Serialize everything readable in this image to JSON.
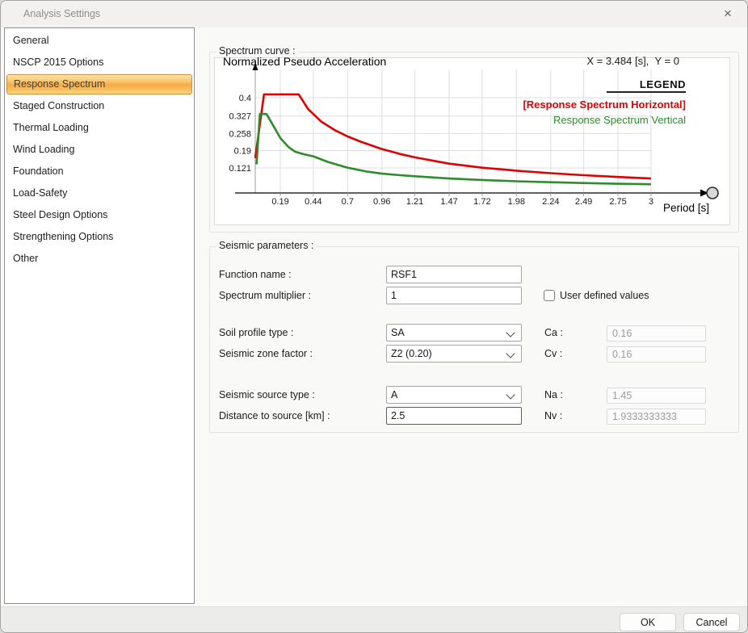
{
  "window": {
    "title": "Analysis Settings",
    "close_icon": "×"
  },
  "sidebar": {
    "selected_index": 2,
    "items": [
      {
        "label": "General"
      },
      {
        "label": "NSCP 2015 Options"
      },
      {
        "label": "Response Spectrum"
      },
      {
        "label": "Staged Construction"
      },
      {
        "label": "Thermal Loading"
      },
      {
        "label": "Wind Loading"
      },
      {
        "label": "Foundation"
      },
      {
        "label": "Load-Safety"
      },
      {
        "label": "Steel Design Options"
      },
      {
        "label": "Strengthening Options"
      },
      {
        "label": "Other"
      }
    ]
  },
  "spectrum_group": {
    "label": "Spectrum curve :",
    "chart_title": "Normalized Pseudo Acceleration",
    "readout": "X = 3.484 [s],  Y = 0",
    "legend_title": "LEGEND",
    "legend": [
      {
        "label": "[Response Spectrum Horizontal]",
        "color": "#e00000"
      },
      {
        "label": "Response Spectrum Vertical",
        "color": "#2e8b2e"
      }
    ],
    "x_axis_label": "Period [s]"
  },
  "chart_data": {
    "type": "line",
    "title": "Normalized Pseudo Acceleration",
    "xlabel": "Period [s]",
    "ylabel": "Normalized Pseudo Acceleration",
    "xlim": [
      0,
      3.3
    ],
    "ylim": [
      0,
      0.45
    ],
    "grid": true,
    "legend_position": "top-right",
    "x_ticks": [
      0.19,
      0.44,
      0.7,
      0.96,
      1.21,
      1.47,
      1.72,
      1.98,
      2.24,
      2.49,
      2.75,
      3
    ],
    "y_ticks": [
      0.4,
      0.327,
      0.258,
      0.19,
      0.121
    ],
    "cursor_readout": {
      "x": 3.484,
      "y": 0,
      "x_units": "s"
    },
    "series": [
      {
        "name": "Response Spectrum Horizontal",
        "color": "#e00000",
        "x": [
          0,
          0.066,
          0.33,
          0.4,
          0.5,
          0.6,
          0.7,
          0.8,
          0.96,
          1.1,
          1.21,
          1.47,
          1.72,
          1.98,
          2.24,
          2.49,
          2.75,
          3.0
        ],
        "y": [
          0.16,
          0.413,
          0.413,
          0.355,
          0.305,
          0.272,
          0.246,
          0.225,
          0.196,
          0.176,
          0.163,
          0.138,
          0.122,
          0.11,
          0.1,
          0.092,
          0.085,
          0.079
        ]
      },
      {
        "name": "Response Spectrum Vertical",
        "color": "#2e8b2e",
        "x": [
          0.01,
          0.035,
          0.085,
          0.13,
          0.19,
          0.25,
          0.3,
          0.37,
          0.44,
          0.55,
          0.7,
          0.85,
          0.96,
          1.1,
          1.21,
          1.47,
          1.72,
          1.98,
          2.24,
          2.49,
          2.75,
          3.0
        ],
        "y": [
          0.135,
          0.335,
          0.335,
          0.295,
          0.24,
          0.205,
          0.186,
          0.175,
          0.167,
          0.145,
          0.122,
          0.106,
          0.098,
          0.092,
          0.088,
          0.079,
          0.073,
          0.068,
          0.064,
          0.061,
          0.058,
          0.056
        ]
      }
    ]
  },
  "seismic_group": {
    "label": "Seismic parameters :",
    "fields": {
      "function_name": {
        "label": "Function name :",
        "value": "RSF1"
      },
      "spectrum_multiplier": {
        "label": "Spectrum multiplier :",
        "value": "1"
      },
      "user_defined_values": {
        "label": "User defined values",
        "checked": false
      },
      "soil_profile_type": {
        "label": "Soil profile type :",
        "value": "SA"
      },
      "seismic_zone_factor": {
        "label": "Seismic zone factor :",
        "value": "Z2 (0.20)"
      },
      "seismic_source_type": {
        "label": "Seismic source type :",
        "value": "A"
      },
      "distance_to_source": {
        "label": "Distance to source [km] :",
        "value": "2.5"
      },
      "ca": {
        "label": "Ca :",
        "value": "0.16"
      },
      "cv": {
        "label": "Cv :",
        "value": "0.16"
      },
      "na": {
        "label": "Na :",
        "value": "1.45"
      },
      "nv": {
        "label": "Nv :",
        "value": "1.9333333333"
      }
    }
  },
  "footer": {
    "ok": "OK",
    "cancel": "Cancel"
  }
}
